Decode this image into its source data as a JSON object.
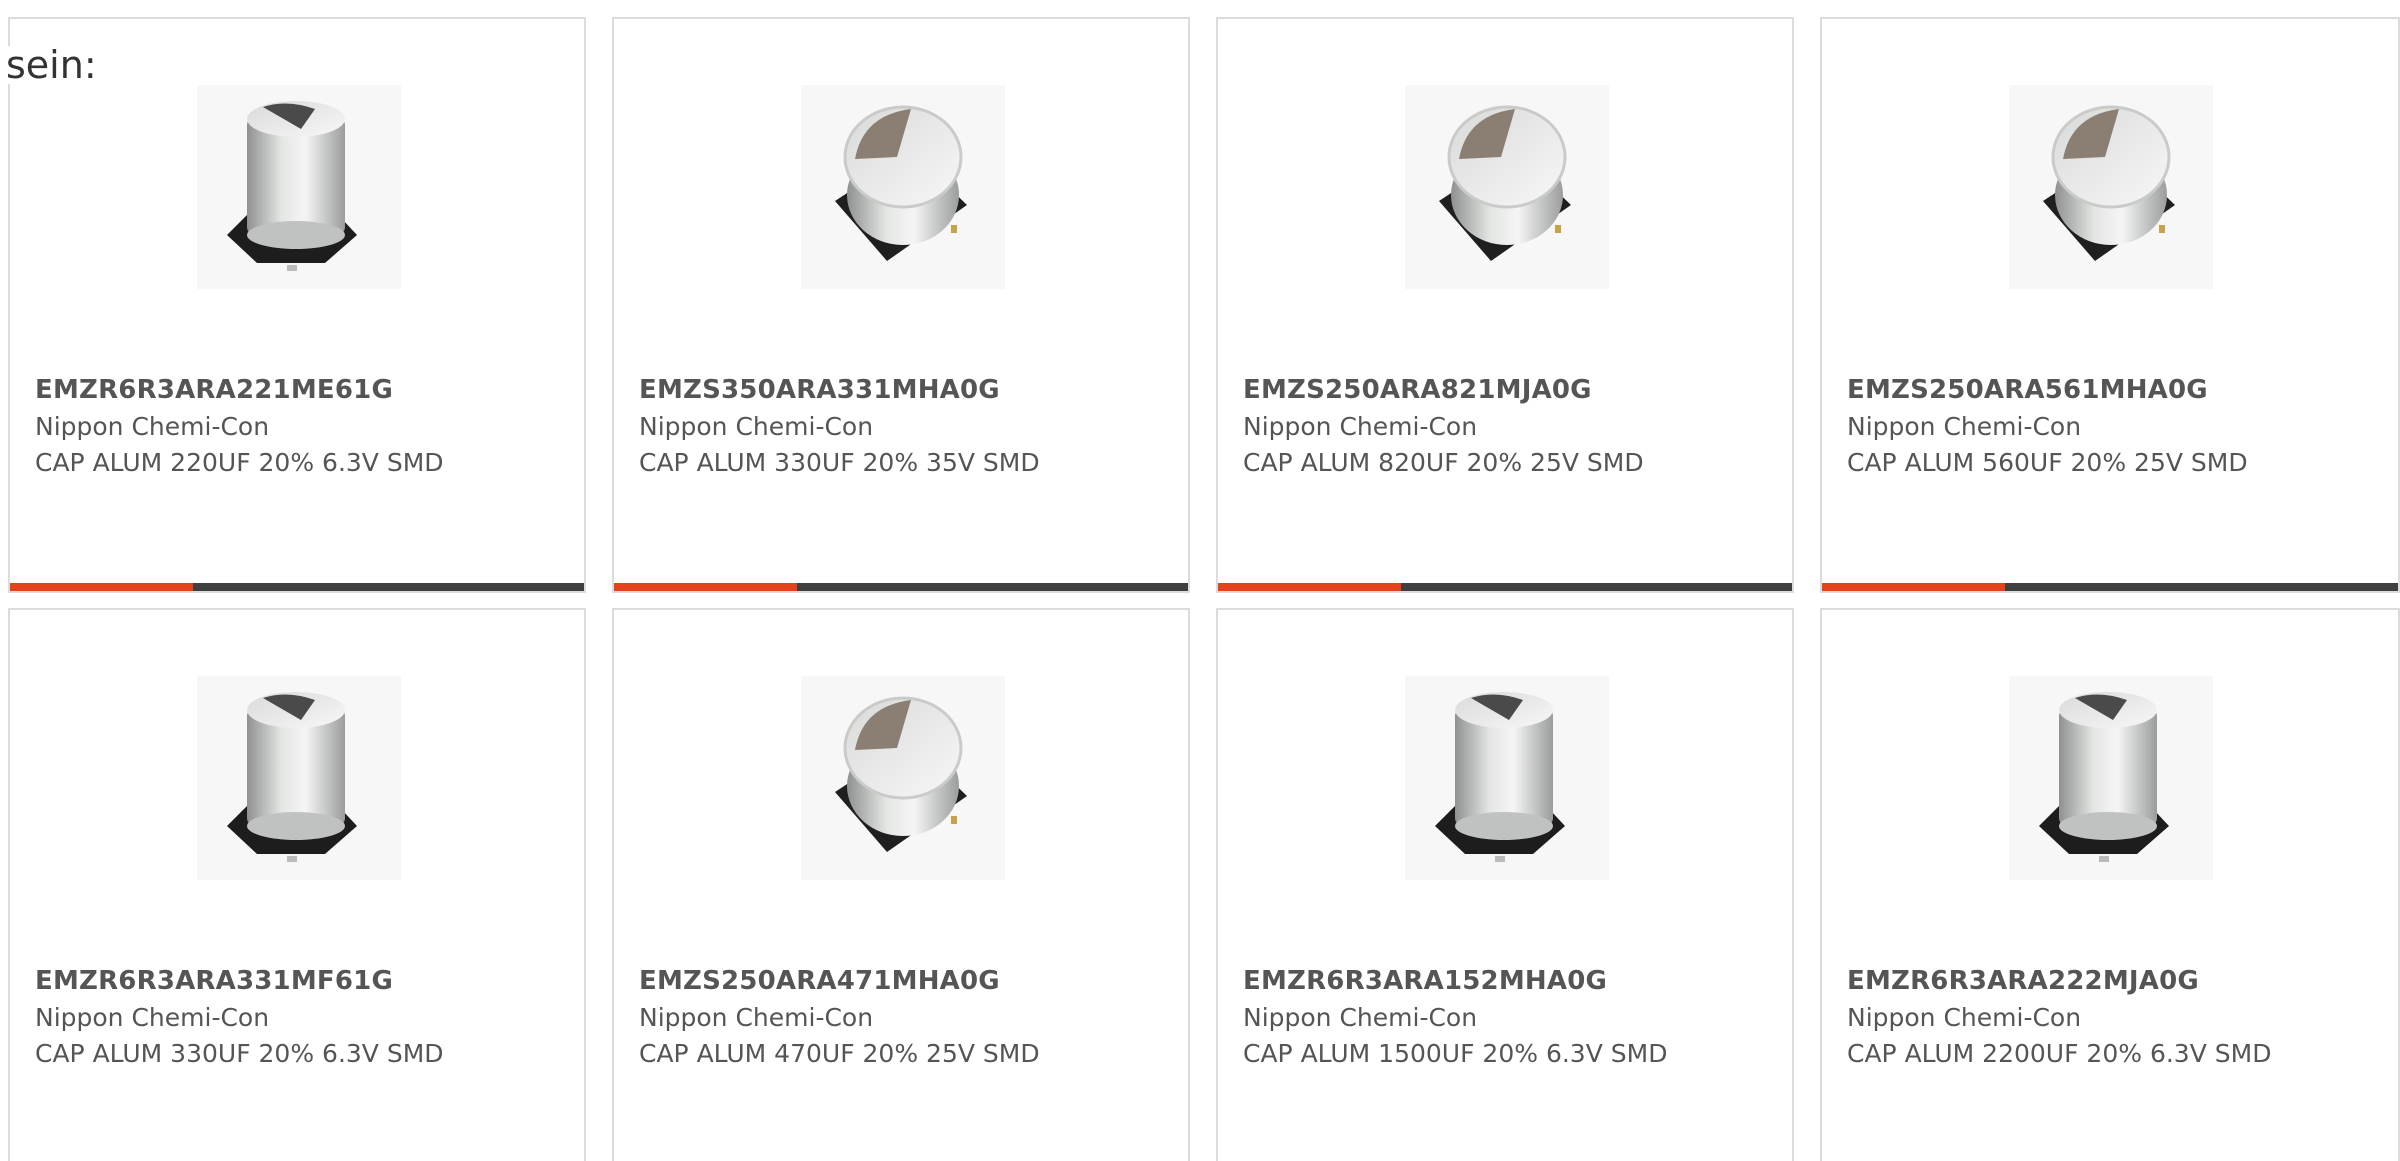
{
  "intro_text": "sein:",
  "colors": {
    "accent": "#e8401b",
    "bar": "#3f3f3f",
    "text": "#555555",
    "border": "#dcdcdc"
  },
  "products": [
    {
      "part": "EMZR6R3ARA221ME61G",
      "manufacturer": "Nippon Chemi-Con",
      "description": "CAP ALUM 220UF 20% 6.3V SMD",
      "image": "tall-capacitor-icon"
    },
    {
      "part": "EMZS350ARA331MHA0G",
      "manufacturer": "Nippon Chemi-Con",
      "description": "CAP ALUM 330UF 20% 35V SMD",
      "image": "short-capacitor-icon"
    },
    {
      "part": "EMZS250ARA821MJA0G",
      "manufacturer": "Nippon Chemi-Con",
      "description": "CAP ALUM 820UF 20% 25V SMD",
      "image": "short-capacitor-icon"
    },
    {
      "part": "EMZS250ARA561MHA0G",
      "manufacturer": "Nippon Chemi-Con",
      "description": "CAP ALUM 560UF 20% 25V SMD",
      "image": "short-capacitor-icon"
    },
    {
      "part": "EMZR6R3ARA331MF61G",
      "manufacturer": "Nippon Chemi-Con",
      "description": "CAP ALUM 330UF 20% 6.3V SMD",
      "image": "tall-capacitor-icon"
    },
    {
      "part": "EMZS250ARA471MHA0G",
      "manufacturer": "Nippon Chemi-Con",
      "description": "CAP ALUM 470UF 20% 25V SMD",
      "image": "short-capacitor-icon"
    },
    {
      "part": "EMZR6R3ARA152MHA0G",
      "manufacturer": "Nippon Chemi-Con",
      "description": "CAP ALUM 1500UF 20% 6.3V SMD",
      "image": "tall-capacitor-icon"
    },
    {
      "part": "EMZR6R3ARA222MJA0G",
      "manufacturer": "Nippon Chemi-Con",
      "description": "CAP ALUM 2200UF 20% 6.3V SMD",
      "image": "tall-capacitor-icon"
    }
  ]
}
